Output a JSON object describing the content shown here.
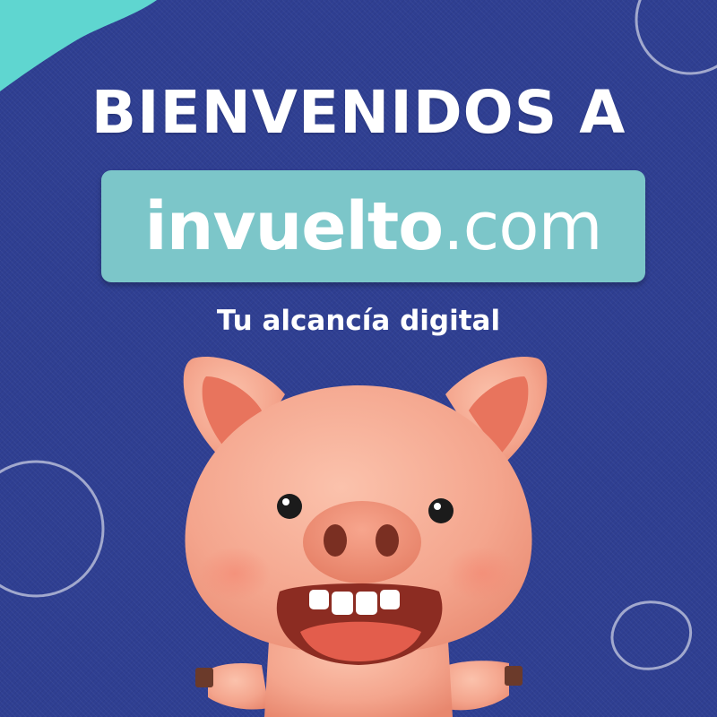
{
  "headline": "BIENVENIDOS A",
  "brand": {
    "name_part": "invuelto",
    "domain_part": ".com"
  },
  "tagline": "Tu alcancía digital",
  "mascot": {
    "icon": "piggy-bank-mascot-icon"
  },
  "colors": {
    "background": "#2f3f92",
    "accent_teal": "#7cc6c9",
    "corner_teal": "#5fd6d0",
    "text": "#ffffff",
    "pig_skin": "#f4a58d"
  }
}
